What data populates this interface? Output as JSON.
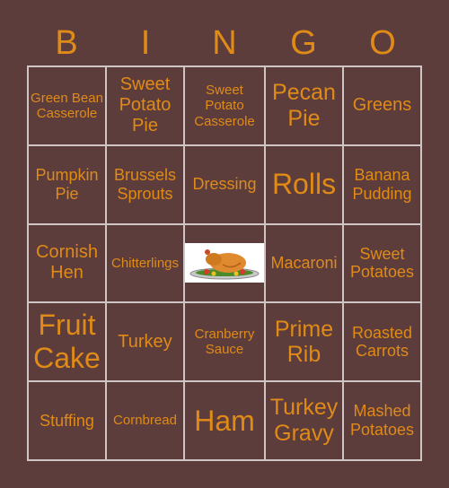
{
  "header": [
    "B",
    "I",
    "N",
    "G",
    "O"
  ],
  "cells": [
    {
      "text": "Green Bean Casserole",
      "size": "s1"
    },
    {
      "text": "Sweet Potato Pie",
      "size": "s3"
    },
    {
      "text": "Sweet Potato Casserole",
      "size": "s1"
    },
    {
      "text": "Pecan Pie",
      "size": "s4"
    },
    {
      "text": "Greens",
      "size": "s3"
    },
    {
      "text": "Pumpkin Pie",
      "size": "s2"
    },
    {
      "text": "Brussels Sprouts",
      "size": "s2"
    },
    {
      "text": "Dressing",
      "size": "s2"
    },
    {
      "text": "Rolls",
      "size": "s5"
    },
    {
      "text": "Banana Pudding",
      "size": "s2"
    },
    {
      "text": "Cornish Hen",
      "size": "s3"
    },
    {
      "text": "Chitterlings",
      "size": "s1"
    },
    {
      "free": true,
      "icon": "roast-turkey-icon"
    },
    {
      "text": "Macaroni",
      "size": "s2"
    },
    {
      "text": "Sweet Potatoes",
      "size": "s2"
    },
    {
      "text": "Fruit Cake",
      "size": "s5"
    },
    {
      "text": "Turkey",
      "size": "s3"
    },
    {
      "text": "Cranberry Sauce",
      "size": "s1"
    },
    {
      "text": "Prime Rib",
      "size": "s4"
    },
    {
      "text": "Roasted Carrots",
      "size": "s2"
    },
    {
      "text": "Stuffing",
      "size": "s2"
    },
    {
      "text": "Cornbread",
      "size": "s1"
    },
    {
      "text": "Ham",
      "size": "s5"
    },
    {
      "text": "Turkey Gravy",
      "size": "s4"
    },
    {
      "text": "Mashed Potatoes",
      "size": "s2"
    }
  ]
}
